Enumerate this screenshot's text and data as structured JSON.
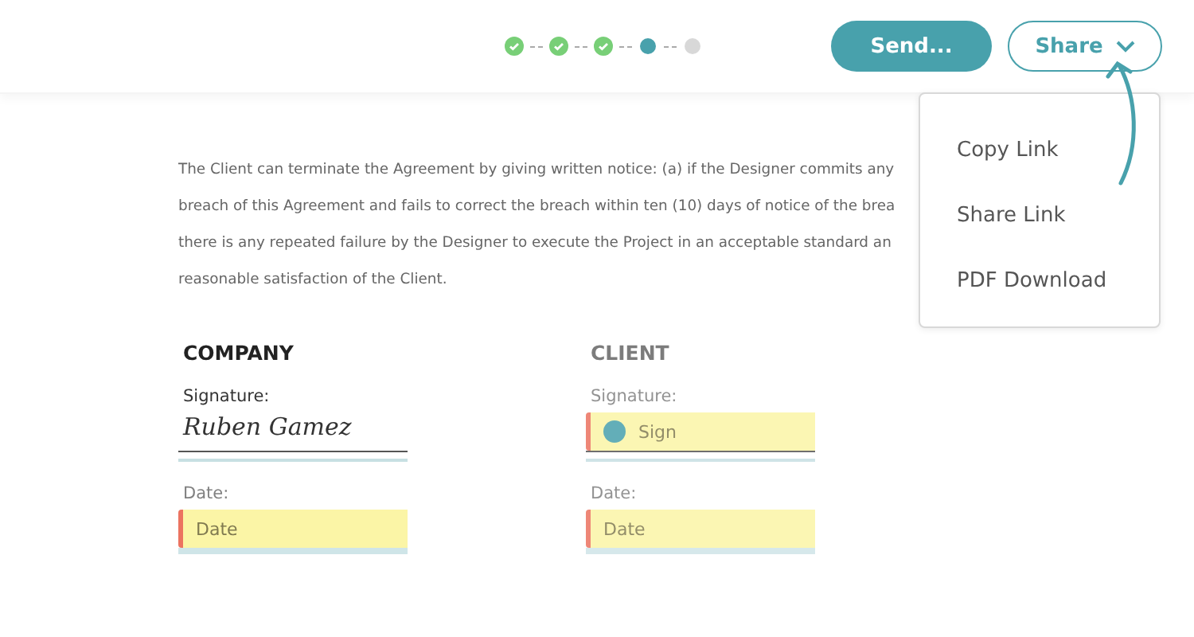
{
  "progress": {
    "steps": [
      {
        "kind": "done"
      },
      {
        "kind": "done"
      },
      {
        "kind": "done"
      },
      {
        "kind": "current"
      },
      {
        "kind": "pending"
      }
    ]
  },
  "actions": {
    "send": "Send...",
    "share": "Share"
  },
  "share_menu": {
    "expanded": true,
    "items": [
      "Copy Link",
      "Share Link",
      "PDF Download"
    ]
  },
  "agreement": {
    "lines": [
      "The Client can terminate the Agreement by giving written notice: (a) if the Designer commits any",
      "breach of this Agreement and fails to correct the breach within ten (10) days of notice of the brea",
      "there is any repeated failure by the Designer to execute the Project in an acceptable standard an",
      "reasonable satisfaction of the Client."
    ]
  },
  "parties": [
    {
      "title": "COMPANY",
      "blurred": false,
      "signature_label": "Signature:",
      "signature": {
        "kind": "signed",
        "text": "Ruben Gamez"
      },
      "date_label": "Date:",
      "date": {
        "placeholder": "Date"
      }
    },
    {
      "title": "CLIENT",
      "blurred": true,
      "signature_label": "Signature:",
      "signature": {
        "kind": "pending",
        "text": "Sign"
      },
      "date_label": "Date:",
      "date": {
        "placeholder": "Date"
      }
    }
  ]
}
